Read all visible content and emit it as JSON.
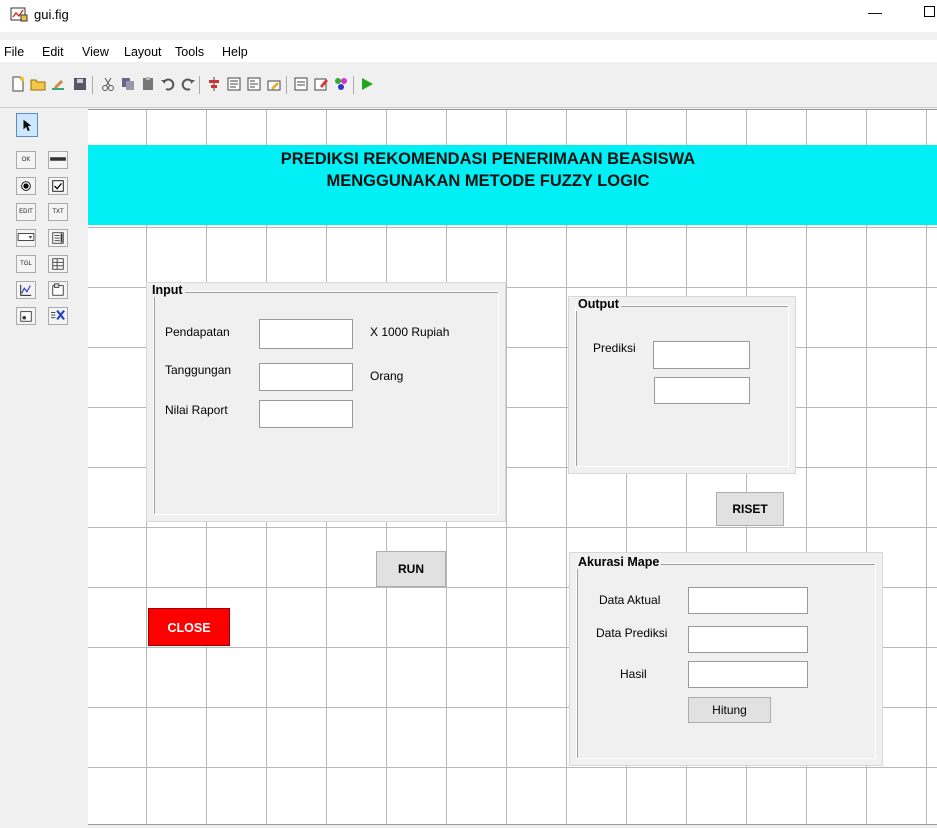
{
  "window": {
    "title": "gui.fig"
  },
  "menu": [
    "File",
    "Edit",
    "View",
    "Layout",
    "Tools",
    "Help"
  ],
  "toolbar_icons": [
    "new-file-icon",
    "open-file-icon",
    "edit-icon",
    "save-icon",
    "cut-icon",
    "copy-icon",
    "paste-icon",
    "undo-icon",
    "redo-icon",
    "align-icon",
    "menu-editor-icon",
    "tab-order-icon",
    "toolbar-editor-icon",
    "editor-icon",
    "property-inspector-icon",
    "object-browser-icon",
    "run-icon"
  ],
  "palette_icons": [
    "select-icon",
    "push-button-icon",
    "slider-icon",
    "radio-button-icon",
    "checkbox-icon",
    "edit-text-icon",
    "static-text-icon",
    "popup-menu-icon",
    "listbox-icon",
    "toggle-button-icon",
    "table-icon",
    "axes-icon",
    "panel-icon",
    "button-group-icon",
    "activex-icon"
  ],
  "palette_labels": {
    "ok": "OK",
    "edit": "EDIT",
    "txt": "TXT",
    "tgl": "TGL"
  },
  "banner": {
    "line1": "PREDIKSI REKOMENDASI PENERIMAAN BEASISWA",
    "line2": "MENGGUNAKAN METODE FUZZY LOGIC",
    "color": "#00f0f5"
  },
  "input_panel": {
    "title": "Input",
    "pendapatan_label": "Pendapatan",
    "pendapatan_unit": "X 1000 Rupiah",
    "tanggungan_label": "Tanggungan",
    "tanggungan_unit": "Orang",
    "raport_label": "Nilai Raport"
  },
  "output_panel": {
    "title": "Output",
    "prediksi_label": "Prediksi"
  },
  "buttons": {
    "riset": "RISET",
    "run": "RUN",
    "close": "CLOSE",
    "hitung": "Hitung"
  },
  "close_color": "#ff0000",
  "akurasi_panel": {
    "title": "Akurasi Mape",
    "aktual_label": "Data Aktual",
    "prediksi_label": "Data Prediksi",
    "hasil_label": "Hasil"
  }
}
